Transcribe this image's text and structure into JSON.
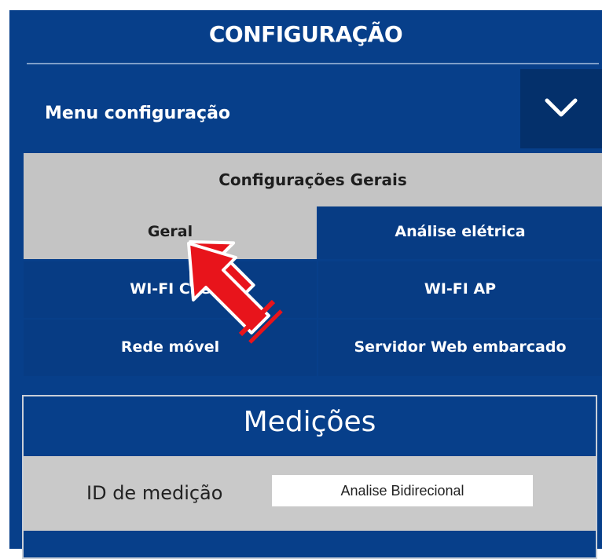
{
  "header": {
    "title": "CONFIGURAÇÃO"
  },
  "menu": {
    "label": "Menu configuração",
    "toggle_icon": "chevron-down-icon"
  },
  "section": {
    "title": "Configurações Gerais"
  },
  "nav": {
    "items": [
      {
        "label": "Geral",
        "active": true
      },
      {
        "label": "Análise elétrica",
        "active": false
      },
      {
        "label": "WI-FI Clie",
        "active": false
      },
      {
        "label": "WI-FI AP",
        "active": false
      },
      {
        "label": "Rede móvel",
        "active": false
      },
      {
        "label": "Servidor Web embarcado",
        "active": false
      }
    ]
  },
  "measurements": {
    "title": "Medições",
    "id_label": "ID de medição",
    "id_value": "Analise Bidirecional"
  },
  "colors": {
    "panel": "#073f8a",
    "active_tab": "#c4c4c4",
    "annotation_arrow": "#e8141b"
  }
}
